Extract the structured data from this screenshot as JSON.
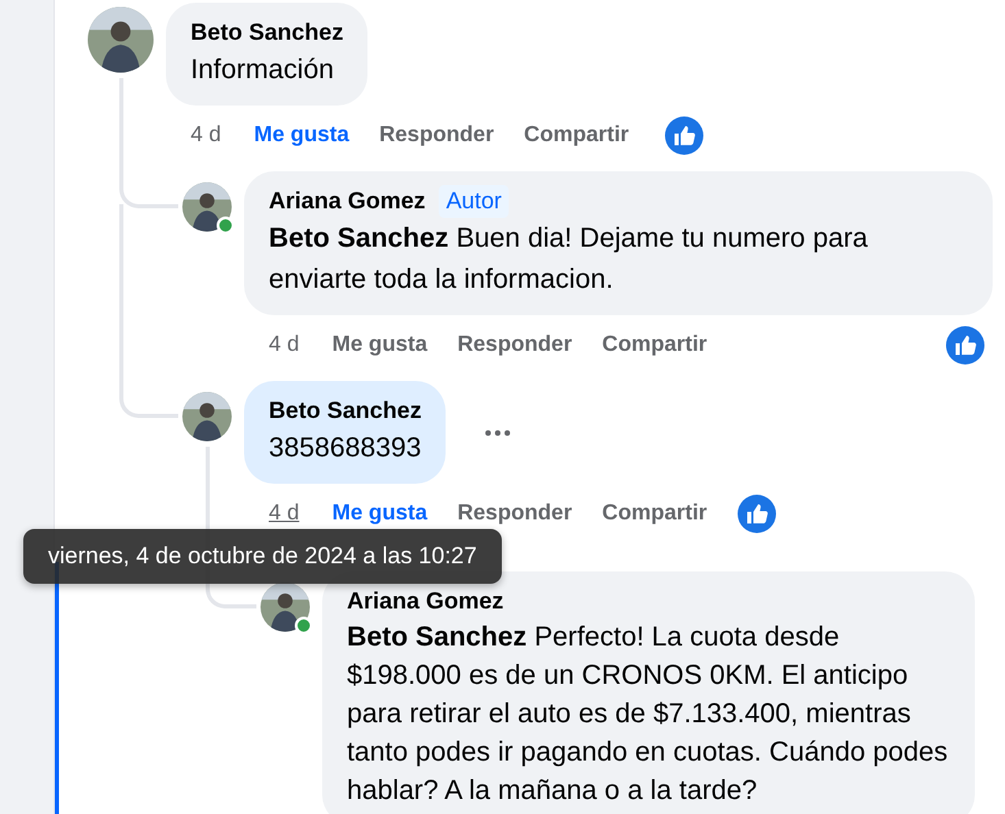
{
  "comments": [
    {
      "author": "Beto Sanchez",
      "text": "Información",
      "time": "4 d",
      "time_hovered": false,
      "liked": true,
      "reacted": true,
      "actions": {
        "like": "Me gusta",
        "reply": "Responder",
        "share": "Compartir"
      },
      "replies": [
        {
          "author": "Ariana Gomez",
          "badge": "Autor",
          "text": "**Beto Sanchez** Buen dia! Dejame tu numero para enviarte toda la informacion.",
          "online": true,
          "time": "4 d",
          "time_hovered": false,
          "liked": false,
          "reacted": true,
          "actions": {
            "like": "Me gusta",
            "reply": "Responder",
            "share": "Compartir"
          }
        },
        {
          "author": "Beto Sanchez",
          "text": "3858688393",
          "highlighted": true,
          "time": "4 d",
          "time_hovered": true,
          "liked": true,
          "reacted": true,
          "more": true,
          "actions": {
            "like": "Me gusta",
            "reply": "Responder",
            "share": "Compartir"
          },
          "replies": [
            {
              "author": "Ariana Gomez",
              "text": "**Beto Sanchez** Perfecto! La cuota desde $198.000 es de un CRONOS 0KM. El anticipo para retirar el auto es de $7.133.400, mientras tanto podes ir pagando en cuotas. Cuándo podes hablar? A la mañana o a la tarde?",
              "online": true
            }
          ]
        }
      ]
    }
  ],
  "tooltip": {
    "text": "viernes, 4 de octubre de 2024 a las 10:27"
  }
}
